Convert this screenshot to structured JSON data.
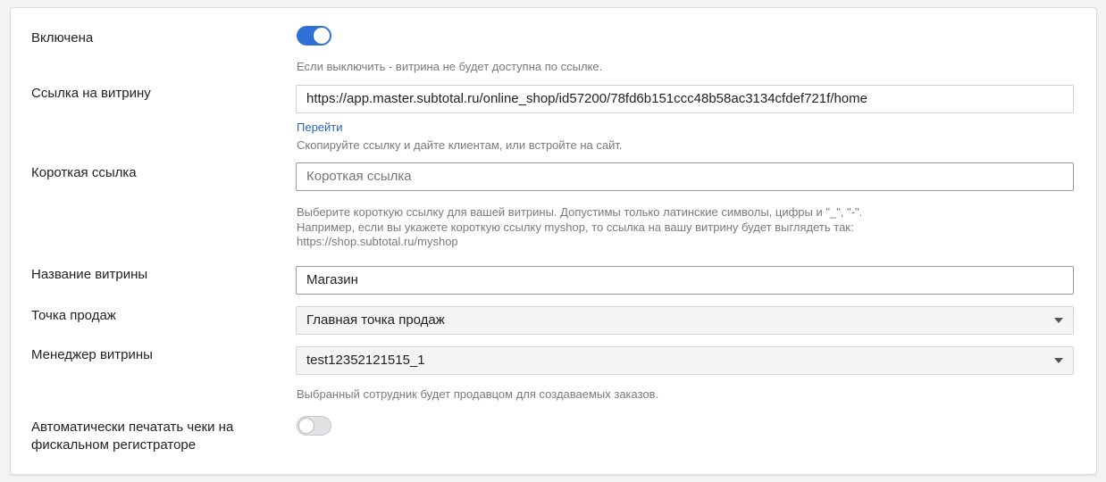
{
  "settings": {
    "enabled": {
      "label": "Включена",
      "state": "on",
      "hint": "Если выключить - витрина не будет доступна по ссылке."
    },
    "shop_link": {
      "label": "Ссылка на витрину",
      "value": "https://app.master.subtotal.ru/online_shop/id57200/78fd6b151ccc48b58ac3134cfdef721f/home",
      "go_link": "Перейти",
      "hint": "Скопируйте ссылку и дайте клиентам, или встройте на сайт."
    },
    "short_link": {
      "label": "Короткая ссылка",
      "placeholder": "Короткая ссылка",
      "hint_line1": "Выберите короткую ссылку для вашей витрины. Допустимы только латинские символы, цифры и \"_\", \"-\".",
      "hint_line2": "Например, если вы укажете короткую ссылку myshop, то ссылка на вашу витрину будет выглядеть так:",
      "hint_line3": "https://shop.subtotal.ru/myshop"
    },
    "shop_name": {
      "label": "Название витрины",
      "value": "Магазин"
    },
    "point_of_sale": {
      "label": "Точка продаж",
      "selected": "Главная точка продаж"
    },
    "manager": {
      "label": "Менеджер витрины",
      "selected": "test12352121515_1",
      "hint": "Выбранный сотрудник будет продавцом для создаваемых заказов."
    },
    "auto_print": {
      "label_line1": "Автоматически печатать чеки на",
      "label_line2": "фискальном регистраторе",
      "state": "off"
    }
  },
  "colors": {
    "accent": "#2f6fd6",
    "link": "#2a63b6",
    "hint": "#7a7a7a"
  }
}
